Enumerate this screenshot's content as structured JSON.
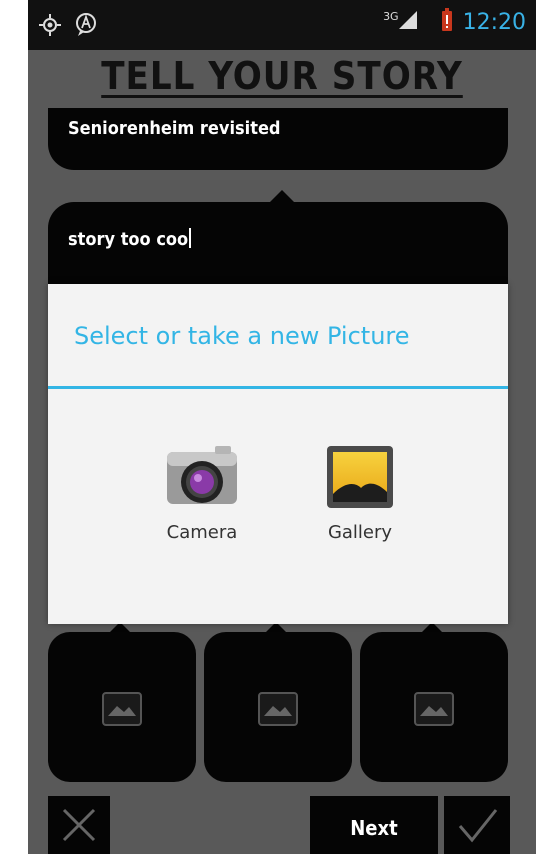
{
  "status_bar": {
    "network": "3G",
    "time": "12:20",
    "icons": [
      "gps-icon",
      "navigation-icon",
      "signal-icon",
      "battery-alert-icon"
    ]
  },
  "app": {
    "title": "TELL YOUR STORY",
    "story_title_value": "Seniorenheim revisited",
    "story_text_value": "story too coo"
  },
  "dialog": {
    "title": "Select or take a new Picture",
    "options": [
      {
        "label": "Camera",
        "icon": "camera-icon"
      },
      {
        "label": "Gallery",
        "icon": "gallery-icon"
      }
    ]
  },
  "image_tiles": [
    {
      "icon": "image-placeholder-icon"
    },
    {
      "icon": "image-placeholder-icon"
    },
    {
      "icon": "image-placeholder-icon"
    }
  ],
  "bottom_bar": {
    "close_icon": "close-icon",
    "next_label": "Next",
    "confirm_icon": "checkmark-icon"
  },
  "colors": {
    "accent": "#33b5e5",
    "background": "#595959",
    "card": "#050505"
  }
}
